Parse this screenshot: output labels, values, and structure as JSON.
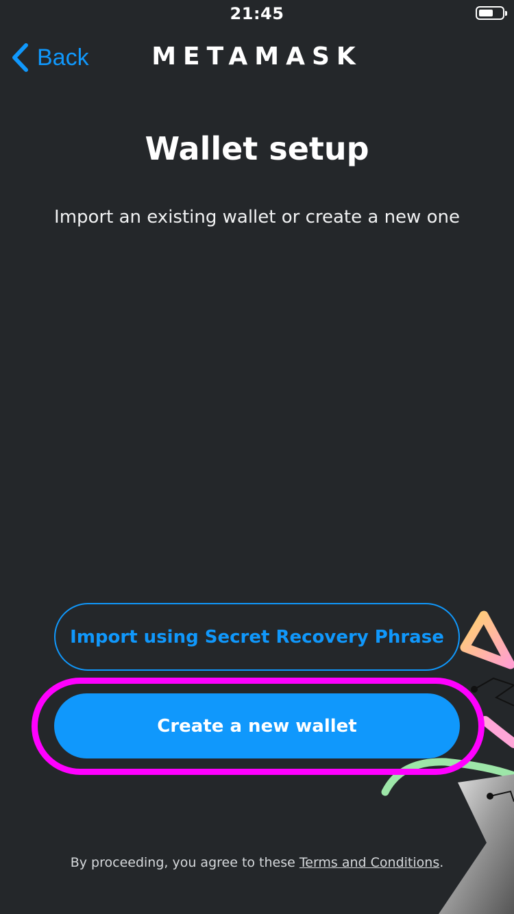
{
  "status_bar": {
    "time": "21:45"
  },
  "nav": {
    "back_label": "Back",
    "logo_text": "METAMASK"
  },
  "main": {
    "title": "Wallet setup",
    "subtitle": "Import an existing wallet or create a new one"
  },
  "actions": {
    "import_label": "Import using Secret Recovery Phrase",
    "create_label": "Create a new wallet"
  },
  "footer": {
    "prefix": "By proceeding, you agree to these ",
    "link": "Terms and Conditions",
    "suffix": "."
  },
  "colors": {
    "background": "#24272a",
    "accent": "#1098fc",
    "highlight": "#ff00ff"
  }
}
